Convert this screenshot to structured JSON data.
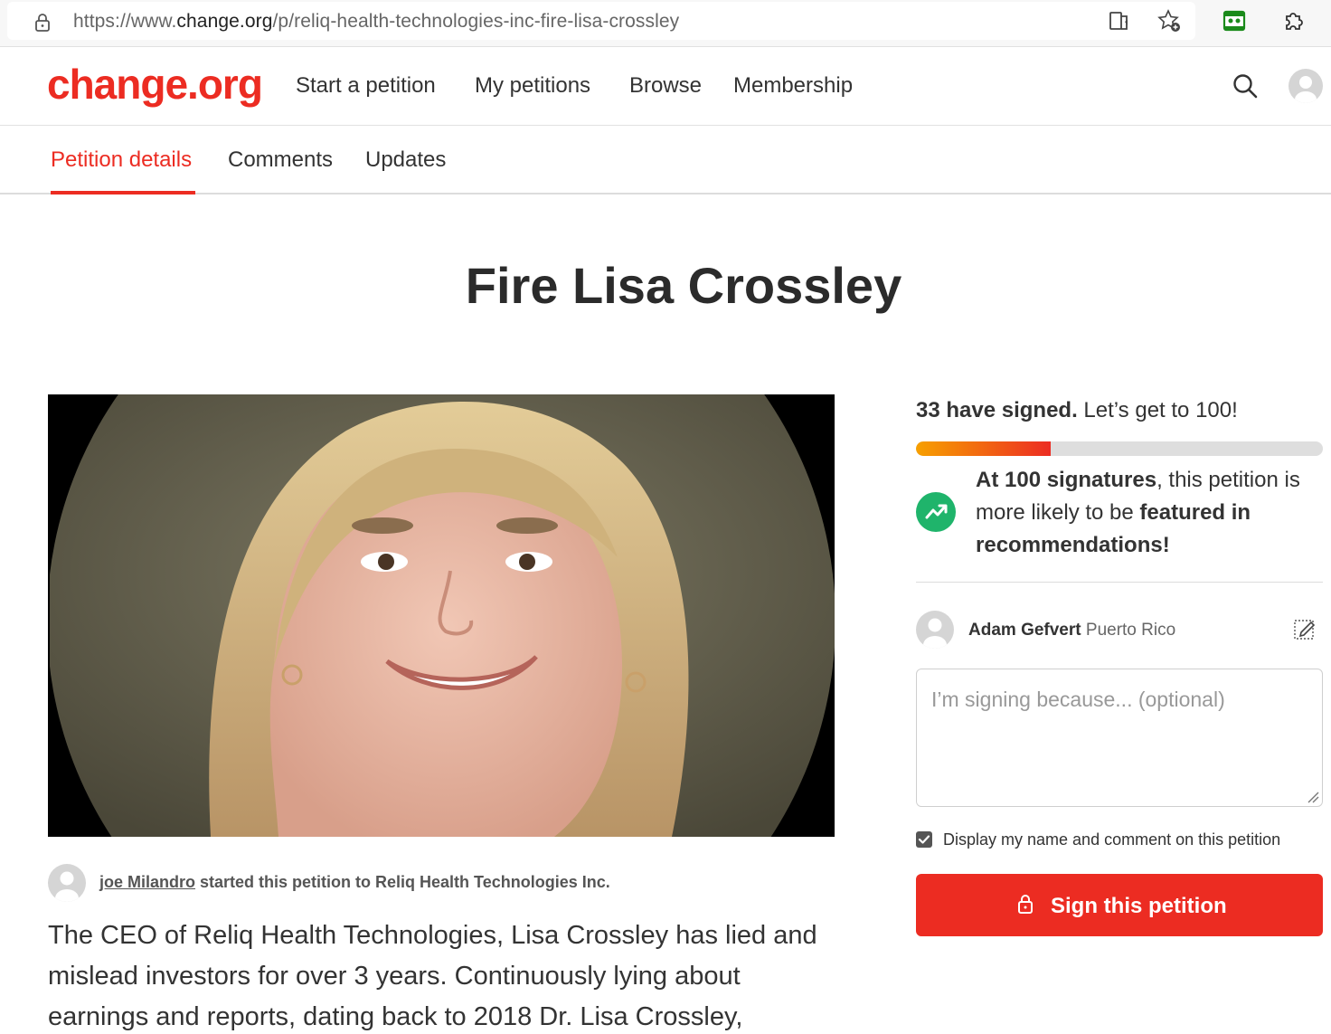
{
  "browser": {
    "url_prefix": "https://www.",
    "url_host": "change.org",
    "url_path": "/p/reliq-health-technologies-inc-fire-lisa-crossley",
    "icons": [
      "lock-icon",
      "reader-view-icon",
      "favorite-star-icon",
      "extension-green-icon",
      "extensions-puzzle-icon"
    ]
  },
  "header": {
    "logo": "change.org",
    "nav": [
      "Start a petition",
      "My petitions",
      "Browse",
      "Membership"
    ],
    "icons": [
      "search-icon",
      "avatar"
    ]
  },
  "tabs": [
    {
      "label": "Petition details",
      "active": true
    },
    {
      "label": "Comments",
      "active": false
    },
    {
      "label": "Updates",
      "active": false
    }
  ],
  "petition": {
    "title": "Fire Lisa Crossley",
    "starter_name": "joe Milandro",
    "starter_suffix": " started this petition to Reliq Health Technologies Inc.",
    "body": "The CEO of Reliq Health Technologies, Lisa Crossley has lied and mislead investors for over 3 years. Continuously lying about earnings and reports, dating back to 2018 Dr. Lisa Crossley,"
  },
  "sidebar": {
    "signed_bold": "33 have signed.",
    "signed_rest": " Let’s get to 100!",
    "signed_count": 33,
    "goal": 100,
    "milestone_bold1": "At 100 signatures",
    "milestone_text": ", this petition is more likely to be ",
    "milestone_bold2": "featured in recommendations!",
    "signer_name": "Adam Gefvert",
    "signer_location": "Puerto Rico",
    "comment_placeholder": "I’m signing because... (optional)",
    "display_checkbox_label": "Display my name and comment on this petition",
    "display_checked": true,
    "sign_button_label": "Sign this petition"
  },
  "colors": {
    "brand": "#ec2c22",
    "trend": "#1fb46b",
    "progress_start": "#f7a000",
    "progress_end": "#ec2c22"
  }
}
